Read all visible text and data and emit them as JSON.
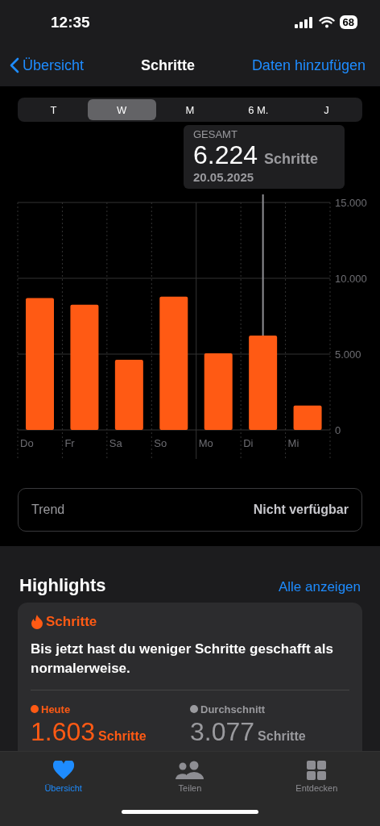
{
  "status_bar": {
    "time": "12:35",
    "battery": "68"
  },
  "nav": {
    "back": "Übersicht",
    "title": "Schritte",
    "action": "Daten hinzufügen"
  },
  "range_tabs": [
    {
      "label": "T",
      "selected": false
    },
    {
      "label": "W",
      "selected": true
    },
    {
      "label": "M",
      "selected": false
    },
    {
      "label": "6 M.",
      "selected": false
    },
    {
      "label": "J",
      "selected": false
    }
  ],
  "tooltip": {
    "label": "GESAMT",
    "value": "6.224",
    "unit": "Schritte",
    "date": "20.05.2025"
  },
  "chart_data": {
    "type": "bar",
    "categories": [
      "Do",
      "Fr",
      "Sa",
      "So",
      "Mo",
      "Di",
      "Mi"
    ],
    "series": [
      {
        "color": "#ff5a14",
        "values": [
          8700,
          8260,
          4630,
          8790,
          5050,
          6224,
          1603
        ]
      }
    ],
    "ylim": [
      0,
      15000
    ],
    "yticks": [
      {
        "value": 0,
        "label": "0"
      },
      {
        "value": 5000,
        "label": "5.000"
      },
      {
        "value": 10000,
        "label": "10.000"
      },
      {
        "value": 15000,
        "label": "15.000"
      }
    ]
  },
  "trend": {
    "label": "Trend",
    "value": "Nicht verfügbar"
  },
  "highlights": {
    "title": "Highlights",
    "link": "Alle anzeigen",
    "card": {
      "category": "Schritte",
      "text": "Bis jetzt hast du weniger Schritte geschafft als normalerweise.",
      "stats": [
        {
          "label": "Heute",
          "value": "1.603",
          "unit": "Schritte",
          "color": "#ff5a14"
        },
        {
          "label": "Durchschnitt",
          "value": "3.077",
          "unit": "Schritte",
          "color": "#9a9a9e"
        }
      ]
    }
  },
  "tab_bar": [
    {
      "label": "Übersicht",
      "selected": true,
      "kind": "heart"
    },
    {
      "label": "Teilen",
      "selected": false,
      "kind": "people"
    },
    {
      "label": "Entdecken",
      "selected": false,
      "kind": "grid"
    }
  ]
}
